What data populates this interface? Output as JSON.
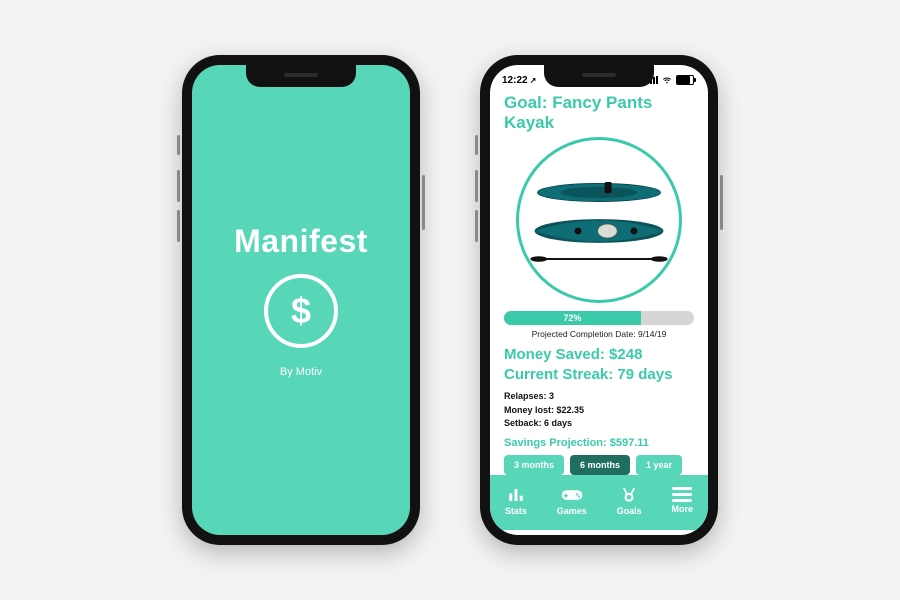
{
  "colors": {
    "accent": "#57d6b8",
    "accent_strong": "#3bcaa9",
    "accent_dark": "#1f6e5f"
  },
  "splash": {
    "title": "Manifest",
    "subtitle": "By Motiv",
    "logo_glyph": "$"
  },
  "statusbar": {
    "time": "12:22",
    "location_arrow": "↗"
  },
  "goal": {
    "prefix": "Goal:",
    "name": "Fancy Pants Kayak",
    "progress_percent": 72,
    "progress_label": "72%",
    "projected_completion_label": "Projected Completion Date:",
    "projected_completion_date": "9/14/19",
    "money_saved_label": "Money Saved:",
    "money_saved_value": "$248",
    "streak_label": "Current Streak:",
    "streak_value": "79 days",
    "relapses_label": "Relapses:",
    "relapses_value": "3",
    "money_lost_label": "Money lost:",
    "money_lost_value": "$22.35",
    "setback_label": "Setback:",
    "setback_value": "6 days",
    "savings_projection_label": "Savings Projection:",
    "savings_projection_value": "$597.11",
    "segments": [
      {
        "label": "3 months",
        "active": false
      },
      {
        "label": "6 months",
        "active": true
      },
      {
        "label": "1 year",
        "active": false
      }
    ]
  },
  "tabbar": [
    {
      "label": "Stats",
      "icon": "stats-icon"
    },
    {
      "label": "Games",
      "icon": "gamepad-icon"
    },
    {
      "label": "Goals",
      "icon": "medal-icon"
    },
    {
      "label": "More",
      "icon": "menu-icon"
    }
  ]
}
